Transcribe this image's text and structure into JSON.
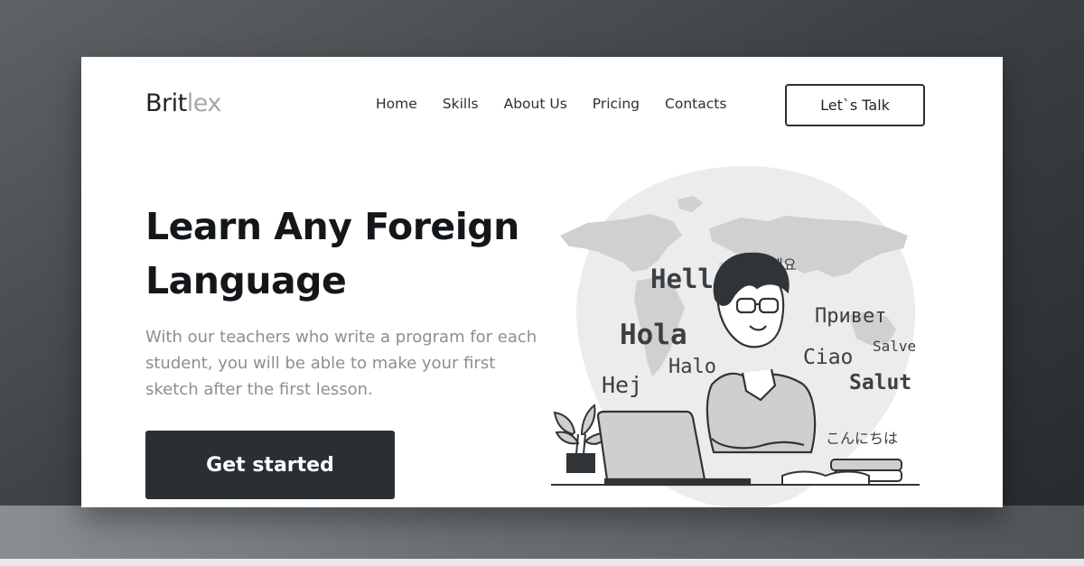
{
  "brand": {
    "name_main": "Brit",
    "name_accent": "lex"
  },
  "nav": {
    "items": [
      {
        "label": "Home"
      },
      {
        "label": "Skills"
      },
      {
        "label": "About Us"
      },
      {
        "label": "Pricing"
      },
      {
        "label": "Contacts"
      }
    ],
    "cta_label": "Let`s Talk"
  },
  "hero": {
    "title_line1": "Learn Any Foreign",
    "title_line2": "Language",
    "subtitle": "With our teachers who write a program for each student, you will be able to make your first sketch after the first lesson.",
    "button_label": "Get started"
  },
  "illustration": {
    "words": {
      "hello": "Hello",
      "korean": "안녕하세요",
      "privet": "Привет",
      "hola": "Hola",
      "halo": "Halo",
      "ciao": "Ciao",
      "salve": "Salve",
      "hej": "Hej",
      "salut": "Salut",
      "japanese": "こんにちは"
    }
  },
  "colors": {
    "dark": "#2a2f33",
    "muted_text": "#8a8f95",
    "logo_accent": "#a6a9ab"
  }
}
